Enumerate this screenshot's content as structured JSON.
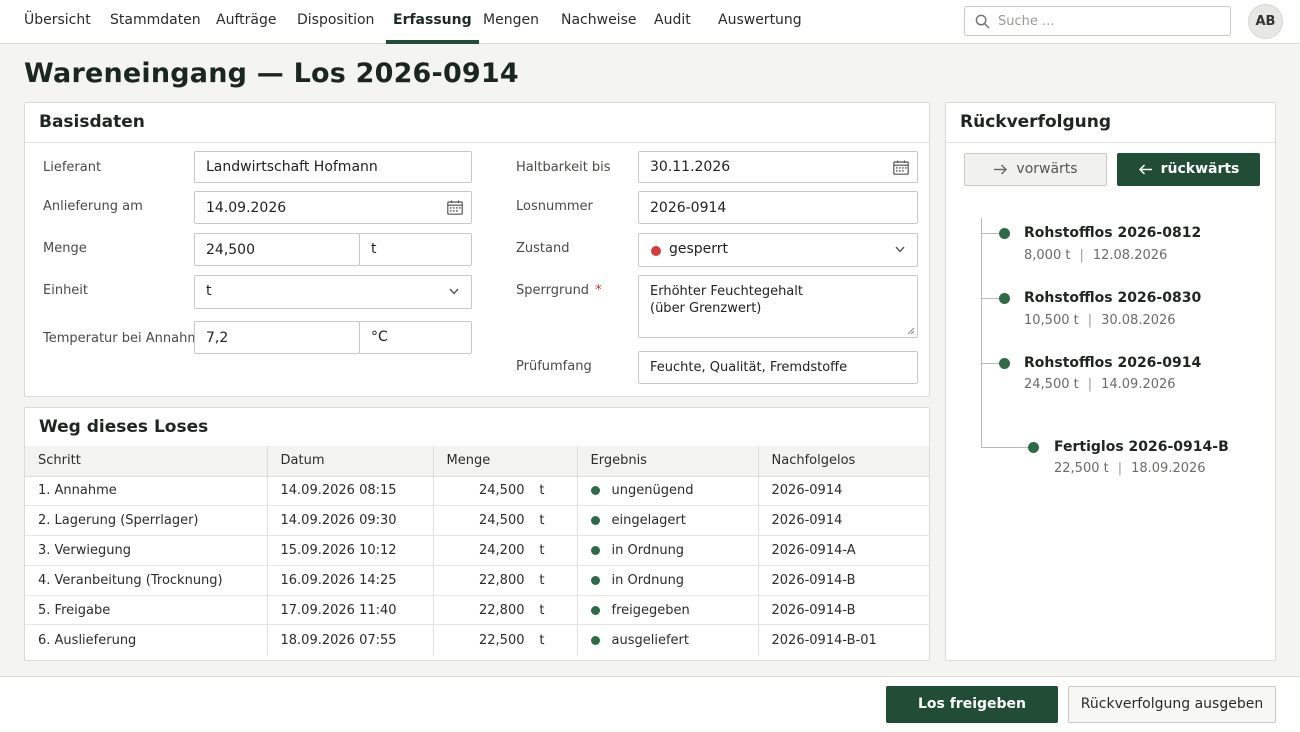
{
  "nav": {
    "items": [
      "Übersicht",
      "Stammdaten",
      "Aufträge",
      "Disposition",
      "Erfassung",
      "Mengen",
      "Nachweise",
      "Audit",
      "Auswertung"
    ],
    "active": "Erfassung",
    "search_placeholder": "Suche ...",
    "avatar_initials": "AB"
  },
  "page": {
    "title": "Wareneingang — Los 2026-0914"
  },
  "basisdaten": {
    "heading": "Basisdaten",
    "lieferant": {
      "label": "Lieferant",
      "value": "Landwirtschaft Hofmann"
    },
    "anlieferung": {
      "label": "Anlieferung am",
      "value": "14.09.2026"
    },
    "menge": {
      "label": "Menge",
      "value": "24,500",
      "unit": "t"
    },
    "einheit": {
      "label": "Einheit",
      "value": "t"
    },
    "temperatur": {
      "label": "Temperatur bei Annahme",
      "value": "7,2",
      "unit": "°C"
    },
    "haltbarkeit": {
      "label": "Haltbarkeit bis",
      "value": "30.11.2026"
    },
    "losnummer": {
      "label": "Losnummer",
      "value": "2026-0914"
    },
    "zustand": {
      "label": "Zustand",
      "value": "gesperrt",
      "status_color": "#d63a3a"
    },
    "sperrgrund": {
      "label": "Sperrgrund",
      "required_mark": "*",
      "value": "Erhöhter Feuchtegehalt\n(über Grenzwert)"
    },
    "pruefumfang": {
      "label": "Prüfumfang",
      "value": "Feuchte, Qualität, Fremdstoffe"
    }
  },
  "weg": {
    "heading": "Weg dieses Loses",
    "columns": [
      "Schritt",
      "Datum",
      "Menge",
      "Ergebnis",
      "Nachfolgelos"
    ],
    "rows": [
      {
        "schritt": "1. Annahme",
        "datum": "14.09.2026 08:15",
        "menge": "24,500",
        "unit": "t",
        "ergebnis": "ungenügend",
        "nachfolgelos": "2026-0914"
      },
      {
        "schritt": "2. Lagerung (Sperrlager)",
        "datum": "14.09.2026 09:30",
        "menge": "24,500",
        "unit": "t",
        "ergebnis": "eingelagert",
        "nachfolgelos": "2026-0914"
      },
      {
        "schritt": "3. Verwiegung",
        "datum": "15.09.2026 10:12",
        "menge": "24,200",
        "unit": "t",
        "ergebnis": "in Ordnung",
        "nachfolgelos": "2026-0914-A"
      },
      {
        "schritt": "4. Veranbeitung (Trocknung)",
        "datum": "16.09.2026 14:25",
        "menge": "22,800",
        "unit": "t",
        "ergebnis": "in Ordnung",
        "nachfolgelos": "2026-0914-B"
      },
      {
        "schritt": "5. Freigabe",
        "datum": "17.09.2026 11:40",
        "menge": "22,800",
        "unit": "t",
        "ergebnis": "freigegeben",
        "nachfolgelos": "2026-0914-B"
      },
      {
        "schritt": "6. Auslieferung",
        "datum": "18.09.2026 07:55",
        "menge": "22,500",
        "unit": "t",
        "ergebnis": "ausgeliefert",
        "nachfolgelos": "2026-0914-B-01"
      }
    ]
  },
  "rueckverfolgung": {
    "heading": "Rückverfolgung",
    "forward_label": "vorwärts",
    "backward_label": "rückwärts",
    "nodes": [
      {
        "title": "Rohstofflos 2026-0812",
        "qty": "8,000 t",
        "date": "12.08.2026"
      },
      {
        "title": "Rohstofflos 2026-0830",
        "qty": "10,500 t",
        "date": "30.08.2026"
      },
      {
        "title": "Rohstofflos 2026-0914",
        "qty": "24,500 t",
        "date": "14.09.2026"
      },
      {
        "title": "Fertiglos 2026-0914-B",
        "qty": "22,500 t",
        "date": "18.09.2026"
      }
    ],
    "separator": "|"
  },
  "actions": {
    "release_label": "Los freigeben",
    "trace_output_label": "Rückverfolgung ausgeben"
  },
  "colors": {
    "accent": "#214d36",
    "ok": "#2d6a45",
    "blocked": "#d63a3a"
  }
}
